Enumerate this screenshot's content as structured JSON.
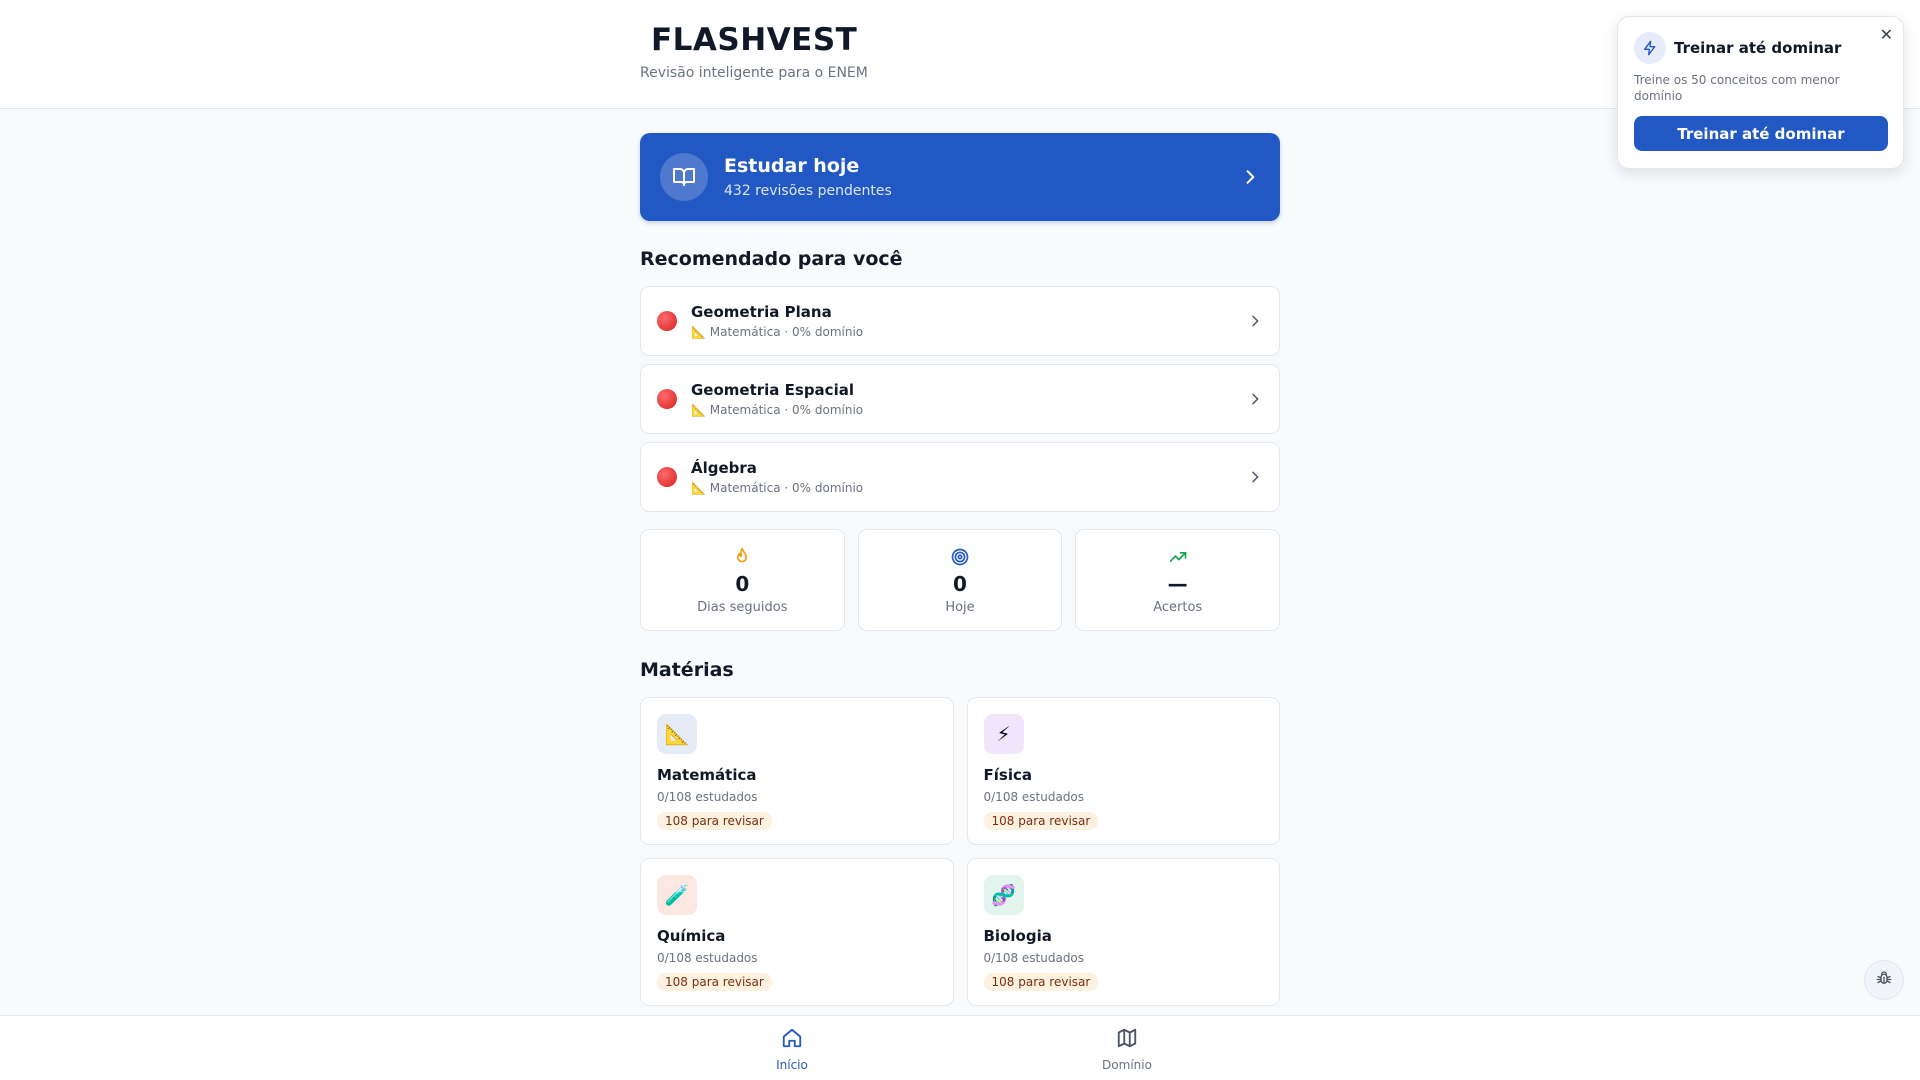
{
  "header": {
    "title": "FLASHVEST",
    "subtitle": "Revisão inteligente para o ENEM"
  },
  "study_today": {
    "title": "Estudar hoje",
    "subtitle": "432 revisões pendentes",
    "icon": "book-open-icon"
  },
  "recommended": {
    "title": "Recomendado para você",
    "items": [
      {
        "name": "Geometria Plana",
        "meta": "📐 Matemática · 0% domínio",
        "status_color": "#e02424"
      },
      {
        "name": "Geometria Espacial",
        "meta": "📐 Matemática · 0% domínio",
        "status_color": "#e02424"
      },
      {
        "name": "Álgebra",
        "meta": "📐 Matemática · 0% domínio",
        "status_color": "#e02424"
      }
    ]
  },
  "stats": [
    {
      "value": "0",
      "label": "Dias seguidos",
      "icon": "flame-icon",
      "color": "#f59e0b"
    },
    {
      "value": "0",
      "label": "Hoje",
      "icon": "target-icon",
      "color": "#2258c3"
    },
    {
      "value": "—",
      "label": "Acertos",
      "icon": "trending-up-icon",
      "color": "#16a34a"
    }
  ],
  "subjects": {
    "title": "Matérias",
    "items": [
      {
        "name": "Matemática",
        "progress": "0/108 estudados",
        "badge": "108 para revisar",
        "emoji": "📐",
        "bg": "#e5ecf8"
      },
      {
        "name": "Física",
        "progress": "0/108 estudados",
        "badge": "108 para revisar",
        "emoji": "⚡",
        "bg": "#f1e6fb"
      },
      {
        "name": "Química",
        "progress": "0/108 estudados",
        "badge": "108 para revisar",
        "emoji": "🧪",
        "bg": "#fde8e1"
      },
      {
        "name": "Biologia",
        "progress": "0/108 estudados",
        "badge": "108 para revisar",
        "emoji": "🧬",
        "bg": "#e1f5ec"
      }
    ]
  },
  "bottom_nav": {
    "items": [
      {
        "label": "Início",
        "icon": "home-icon",
        "active": true
      },
      {
        "label": "Domínio",
        "icon": "map-icon",
        "active": false
      }
    ]
  },
  "popup": {
    "title": "Treinar até dominar",
    "description": "Treine os 50 conceitos com menor domínio",
    "button_label": "Treinar até dominar",
    "close_glyph": "✕",
    "icon": "lightning-icon"
  },
  "debug": {
    "icon": "bug-icon"
  },
  "colors": {
    "primary": "#2258c3",
    "badge_bg": "#fdf2e0",
    "text_muted": "#6b7280"
  }
}
